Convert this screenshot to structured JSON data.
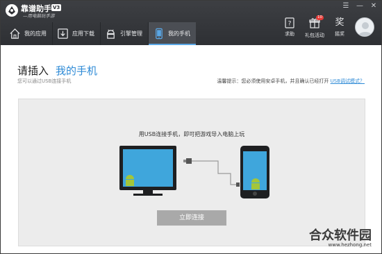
{
  "app": {
    "name": "靠谱助手",
    "version": "V3",
    "slogan": "—用电脑玩手游"
  },
  "window_controls": {
    "menu_icon": "menu-icon",
    "minimize_icon": "minimize-icon",
    "close_icon": "close-icon"
  },
  "nav": {
    "items": [
      {
        "label": "我的应用",
        "icon": "home-icon"
      },
      {
        "label": "应用下载",
        "icon": "download-icon"
      },
      {
        "label": "引擎管理",
        "icon": "android-icon"
      },
      {
        "label": "我的手机",
        "icon": "phone-icon"
      }
    ]
  },
  "tools": {
    "help": "求助",
    "gift": "礼包活动",
    "gift_badge": "10",
    "shake": "摇奖",
    "shake_glyph": "奖"
  },
  "page": {
    "title": "请插入",
    "title_highlight": "我的手机",
    "subtitle": "您可以通过USB连接手机",
    "tip_prefix": "温馨提示：您必须使用安卓手机，并且确认已经打开 ",
    "tip_link": "USB调试模式？"
  },
  "panel": {
    "instruction": "用USB连接手机，即可把游戏导入电脑上玩",
    "connect_button": "立即连接"
  },
  "watermark": {
    "title": "合众软件园",
    "url": "www.hezhong.net"
  },
  "colors": {
    "header_bg": "#2e3034",
    "accent_blue": "#2d8ad6",
    "screen_blue": "#3fa6dc",
    "android_green": "#a4c639",
    "button_gray": "#a9a9a9",
    "panel_bg": "#ececec"
  }
}
